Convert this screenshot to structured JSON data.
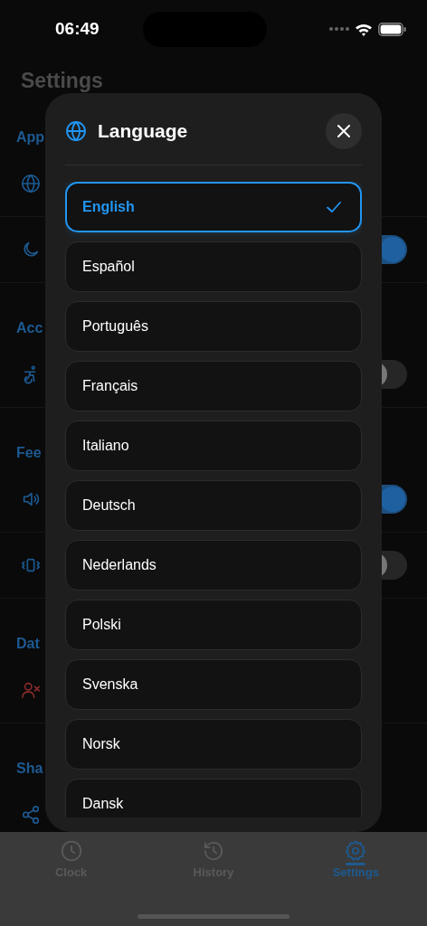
{
  "status_bar": {
    "time": "06:49"
  },
  "settings": {
    "title": "Settings",
    "sections": [
      {
        "heading": "App",
        "rows": [
          {
            "kind": "link"
          },
          {
            "kind": "toggle",
            "on": true
          }
        ]
      },
      {
        "heading": "Acc",
        "rows": [
          {
            "kind": "toggle",
            "on": false
          }
        ]
      },
      {
        "heading": "Fee",
        "rows": [
          {
            "kind": "toggle",
            "on": true
          },
          {
            "kind": "toggle",
            "on": false
          }
        ]
      },
      {
        "heading": "Dat",
        "rows": [
          {
            "kind": "link"
          }
        ]
      },
      {
        "heading": "Sha",
        "rows": [
          {
            "kind": "link"
          }
        ]
      }
    ]
  },
  "language_dialog": {
    "title": "Language",
    "options": [
      {
        "label": "English",
        "selected": true
      },
      {
        "label": "Español",
        "selected": false
      },
      {
        "label": "Português",
        "selected": false
      },
      {
        "label": "Français",
        "selected": false
      },
      {
        "label": "Italiano",
        "selected": false
      },
      {
        "label": "Deutsch",
        "selected": false
      },
      {
        "label": "Nederlands",
        "selected": false
      },
      {
        "label": "Polski",
        "selected": false
      },
      {
        "label": "Svenska",
        "selected": false
      },
      {
        "label": "Norsk",
        "selected": false
      },
      {
        "label": "Dansk",
        "selected": false
      }
    ]
  },
  "tab_bar": [
    {
      "label": "Clock",
      "selected": false
    },
    {
      "label": "History",
      "selected": false
    },
    {
      "label": "Settings",
      "selected": true
    }
  ]
}
